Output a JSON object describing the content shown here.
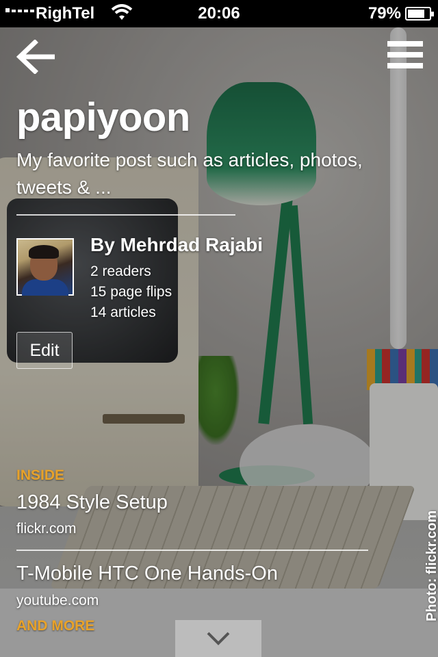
{
  "status_bar": {
    "carrier": "RighTel",
    "time": "20:06",
    "battery_percent": "79%",
    "battery_level": 0.79,
    "signal_bars_filled": 1,
    "icons": [
      "signal-icon",
      "wifi-icon",
      "battery-icon"
    ]
  },
  "nav": {
    "back_icon": "arrow-left-icon",
    "menu_icon": "hamburger-menu-icon"
  },
  "magazine": {
    "title": "papiyoon",
    "description": "My favorite post such as articles, photos, tweets & ..."
  },
  "author": {
    "name": "By Mehrdad Rajabi",
    "readers": "2 readers",
    "page_flips": "15 page flips",
    "articles": "14 articles",
    "edit_label": "Edit"
  },
  "inside": {
    "label": "INSIDE",
    "items": [
      {
        "title": "1984 Style Setup",
        "source": "flickr.com"
      },
      {
        "title": "T-Mobile HTC One Hands-On",
        "source": "youtube.com"
      }
    ],
    "more_label": "AND MORE"
  },
  "photo_credit": "Photo: flickr.com",
  "scroll_icon": "chevron-down-icon",
  "colors": {
    "accent": "#e8a22a",
    "status_bar_bg": "#000000"
  }
}
